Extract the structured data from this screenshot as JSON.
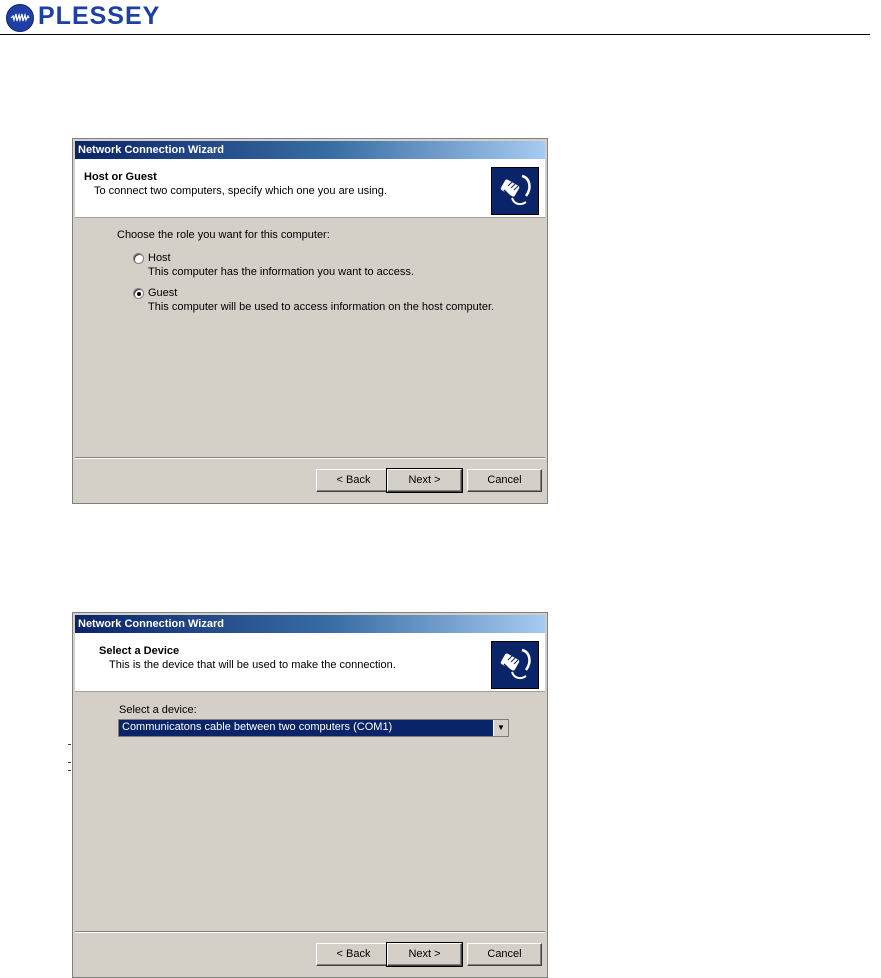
{
  "header": {
    "brand": "PLESSEY",
    "accent_color": "#1d3fa6"
  },
  "dialogs": [
    {
      "window_title": "Network Connection Wizard",
      "heading": "Host or Guest",
      "subheading": "To connect two computers, specify which one you are using.",
      "prompt": "Choose the role you want for this computer:",
      "options": [
        {
          "label": "Host",
          "description": "This computer has the information you want to access.",
          "selected": false
        },
        {
          "label": "Guest",
          "description": "This computer will be used to access information on the host computer.",
          "selected": true
        }
      ],
      "buttons": {
        "back": "< Back",
        "next": "Next >",
        "cancel": "Cancel"
      }
    },
    {
      "window_title": "Network Connection Wizard",
      "heading": "Select a Device",
      "subheading": "This is the device that will be used to make the connection.",
      "prompt": "Select a device:",
      "device_value": "Communicatons cable between two computers (COM1)",
      "buttons": {
        "back": "< Back",
        "next": "Next >",
        "cancel": "Cancel"
      }
    }
  ],
  "icons": {
    "logo": "plessey-logo-icon",
    "wizard": "network-cable-plug-icon"
  }
}
